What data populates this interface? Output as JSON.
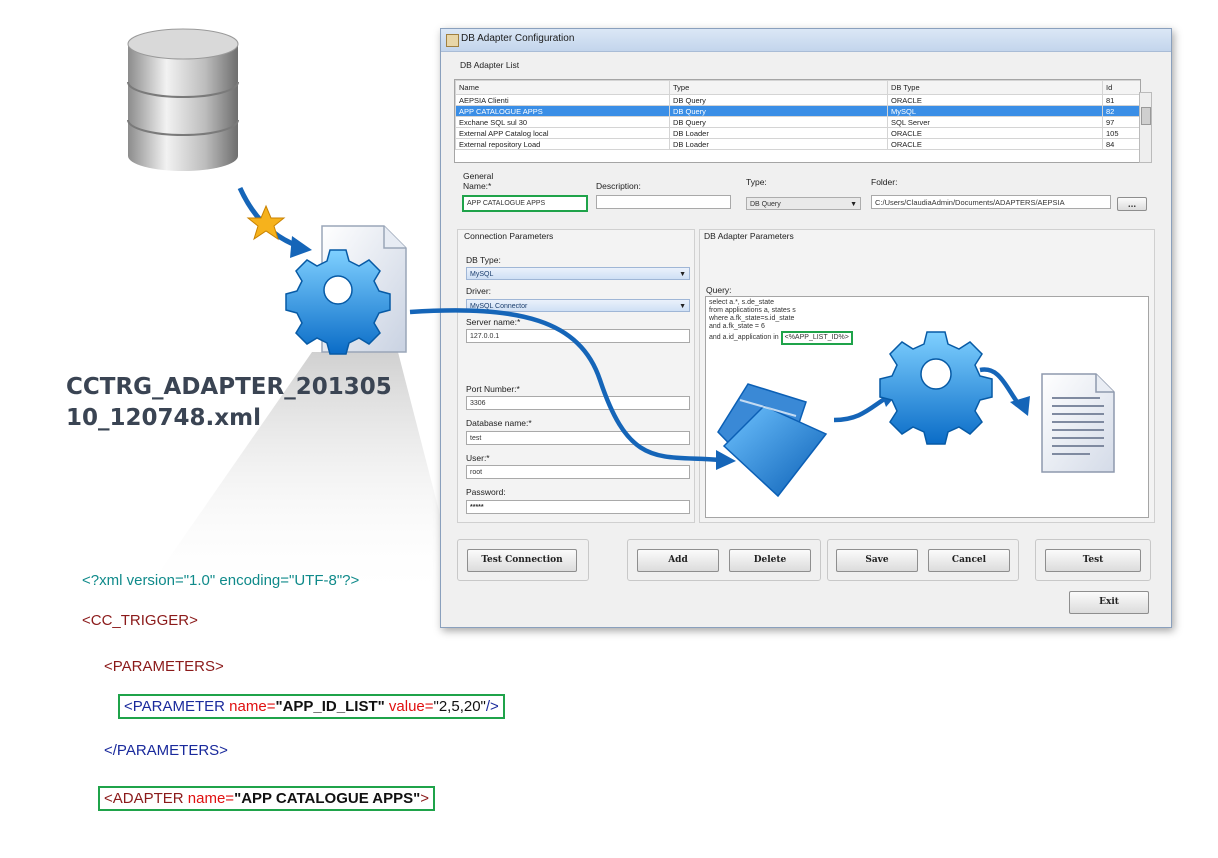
{
  "window": {
    "title": "DB Adapter Configuration",
    "list_group_label": "DB Adapter List",
    "columns": [
      "Name",
      "Type",
      "DB Type",
      "Id"
    ],
    "rows": [
      {
        "name": "AEPSIA Clienti",
        "type": "DB Query",
        "db_type": "ORACLE",
        "id": "81"
      },
      {
        "name": "APP CATALOGUE APPS",
        "type": "DB Query",
        "db_type": "MySQL",
        "id": "82",
        "selected": true
      },
      {
        "name": "Exchane SQL sul 30",
        "type": "DB Query",
        "db_type": "SQL Server",
        "id": "97"
      },
      {
        "name": "External APP Catalog local",
        "type": "DB Loader",
        "db_type": "ORACLE",
        "id": "105"
      },
      {
        "name": "External repository Load",
        "type": "DB Loader",
        "db_type": "ORACLE",
        "id": "84"
      }
    ],
    "general": {
      "label": "General",
      "name_label": "Name:*",
      "name_value": "APP CATALOGUE APPS",
      "description_label": "Description:",
      "description_value": "",
      "type_label": "Type:",
      "type_value": "DB Query",
      "folder_label": "Folder:",
      "folder_value": "C:/Users/ClaudiaAdmin/Documents/ADAPTERS/AEPSIA",
      "browse_label": "..."
    },
    "connection": {
      "label": "Connection Parameters",
      "db_type_label": "DB Type:",
      "db_type_value": "MySQL",
      "driver_label": "Driver:",
      "driver_value": "MySQL Connector",
      "server_label": "Server name:*",
      "server_value": "127.0.0.1",
      "port_label": "Port Number:*",
      "port_value": "3306",
      "database_label": "Database name:*",
      "database_value": "test",
      "user_label": "User:*",
      "user_value": "root",
      "password_label": "Password:",
      "password_value": "*****"
    },
    "adapter_params": {
      "label": "DB Adapter Parameters",
      "query_label": "Query:",
      "query_lines": [
        "select a.*, s.de_state",
        "from applications a, states s",
        "where a.fk_state=s.id_state",
        "and a.fk_state = 6",
        "and a.id_application in "
      ],
      "query_param": "<%APP_LIST_ID%>"
    },
    "buttons": {
      "test_connection": "Test Connection",
      "add": "Add",
      "delete": "Delete",
      "save": "Save",
      "cancel": "Cancel",
      "test": "Test",
      "exit": "Exit"
    }
  },
  "file": {
    "name_line1": "CCTRG_ADAPTER_201305",
    "name_line2": "10_120748.xml"
  },
  "xml": {
    "declaration": "<?xml version=\"1.0\" encoding=\"UTF-8\"?>",
    "root_open": "<CC_TRIGGER>",
    "params_open": "<PARAMETERS>",
    "param_tag": "<PARAMETER",
    "param_name_attr": "name=",
    "param_name_value": "\"APP_ID_LIST\"",
    "param_value_attr": "value=",
    "param_value_value": "\"2,5,20\"",
    "param_close": "/>",
    "params_close": "</PARAMETERS>",
    "adapter_tag": "<ADAPTER",
    "adapter_name_attr": "name=",
    "adapter_name_value": "\"APP CATALOGUE APPS\"",
    "adapter_close": ">"
  },
  "colors": {
    "highlight": "#1fa34a",
    "arrow": "#1565b8",
    "selection": "#3a8ee6"
  },
  "icons": [
    "database-icon",
    "star-icon",
    "xml-file-gear-icon",
    "folder-icon",
    "gear-icon",
    "document-icon"
  ]
}
